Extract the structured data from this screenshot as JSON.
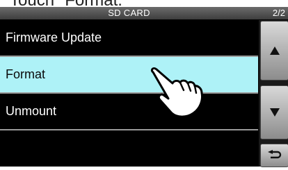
{
  "caption": "Touch \"Format.\"",
  "titlebar": {
    "title": "SD CARD",
    "page": "2/2"
  },
  "menu": {
    "items": [
      {
        "label": "Firmware Update"
      },
      {
        "label": "Format",
        "selected": true
      },
      {
        "label": "Unmount"
      }
    ]
  },
  "controls": {
    "up_icon": "triangle-up-icon",
    "down_icon": "triangle-down-icon",
    "back_icon": "return-arrow-icon"
  },
  "colors": {
    "selected_row": "#aef2f7",
    "screen_background": "#000000"
  }
}
